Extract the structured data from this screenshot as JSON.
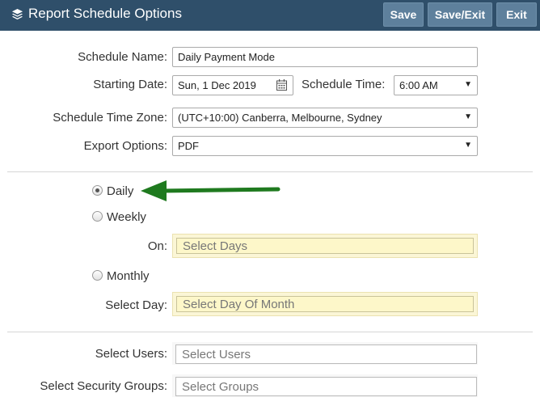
{
  "header": {
    "title": "Report Schedule Options",
    "title_icon": "layers-icon",
    "save_label": "Save",
    "save_exit_label": "Save/Exit",
    "exit_label": "Exit",
    "bg_color": "#2f4f6a",
    "button_color": "#5e809c"
  },
  "form": {
    "schedule_name_label": "Schedule Name:",
    "schedule_name_value": "Daily Payment Mode",
    "starting_date_label": "Starting Date:",
    "starting_date_value": "Sun, 1 Dec 2019",
    "schedule_time_label": "Schedule Time:",
    "schedule_time_value": "6:00 AM",
    "time_zone_label": "Schedule Time Zone:",
    "time_zone_value": "(UTC+10:00) Canberra, Melbourne, Sydney",
    "export_label": "Export Options:",
    "export_value": "PDF"
  },
  "frequency": {
    "daily_label": "Daily",
    "weekly_label": "Weekly",
    "on_label": "On:",
    "select_days_placeholder": "Select Days",
    "monthly_label": "Monthly",
    "select_day_label": "Select Day:",
    "select_day_of_month_placeholder": "Select Day Of Month",
    "selected": "Daily"
  },
  "recipients": {
    "users_label": "Select Users:",
    "users_placeholder": "Select Users",
    "groups_label": "Select Security Groups:",
    "groups_placeholder": "Select Groups"
  },
  "annotation": {
    "arrow_color": "#1f7a1f",
    "arrow_target": "Daily"
  }
}
